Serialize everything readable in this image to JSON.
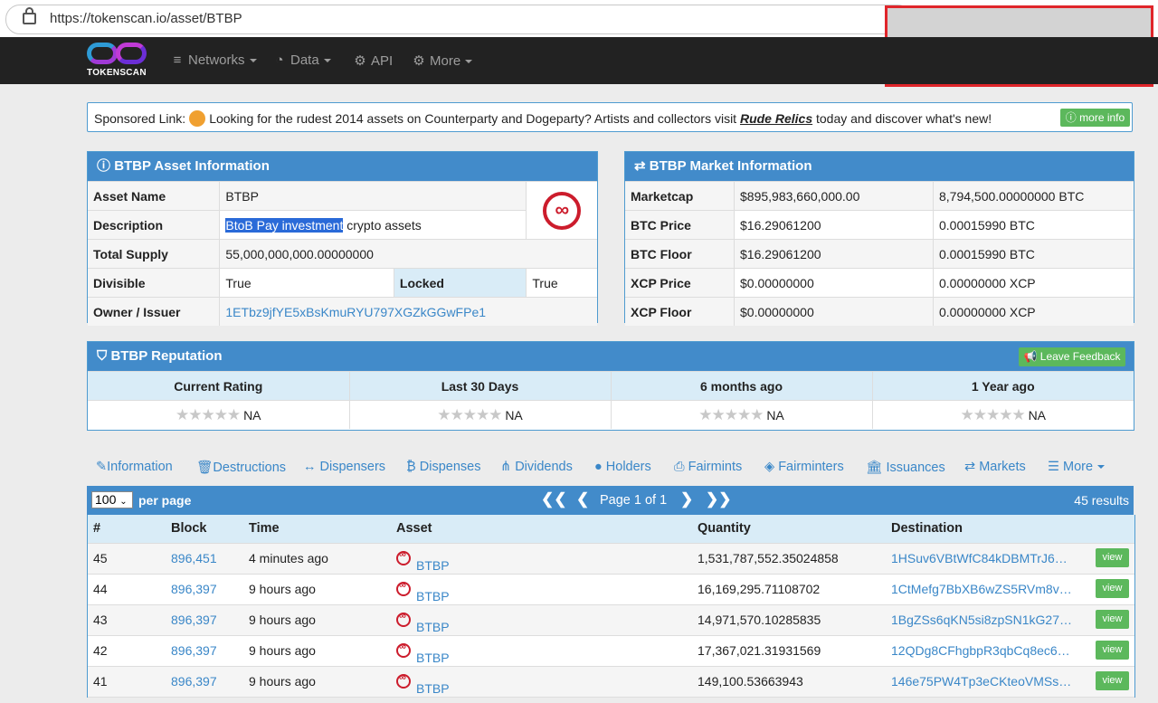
{
  "browser": {
    "url": "https://tokenscan.io/asset/BTBP"
  },
  "nav": {
    "logo_text": "TOKENSCAN",
    "items": [
      {
        "label": "Networks",
        "icon": "database-icon"
      },
      {
        "label": "Data",
        "icon": "dashboard-icon"
      },
      {
        "label": "API",
        "icon": "gears-icon"
      },
      {
        "label": "More",
        "icon": "gear-icon"
      }
    ]
  },
  "sponsor": {
    "prefix": "Sponsored Link:",
    "text1": "Looking for the rudest 2014 assets on Counterparty and Dogeparty? Artists and collectors visit",
    "link": "Rude Relics",
    "text2": "today and discover what's new!",
    "button": "more info"
  },
  "asset_info": {
    "title": "BTBP Asset Information",
    "rows": {
      "name_label": "Asset Name",
      "name_value": "BTBP",
      "desc_label": "Description",
      "desc_highlight": "BtoB Pay investment",
      "desc_rest": " crypto assets",
      "supply_label": "Total Supply",
      "supply_value": "55,000,000,000.00000000",
      "divisible_label": "Divisible",
      "divisible_value": "True",
      "locked_label": "Locked",
      "locked_value": "True",
      "owner_label": "Owner / Issuer",
      "owner_value": "1ETbz9jfYE5xBsKmuRYU797XGZkGGwFPe1"
    }
  },
  "market_info": {
    "title": "BTBP Market Information",
    "rows": [
      {
        "label": "Marketcap",
        "usd": "$895,983,660,000.00",
        "alt": "8,794,500.00000000 BTC"
      },
      {
        "label": "BTC Price",
        "usd": "$16.29061200",
        "alt": "0.00015990 BTC"
      },
      {
        "label": "BTC Floor",
        "usd": "$16.29061200",
        "alt": "0.00015990 BTC"
      },
      {
        "label": "XCP Price",
        "usd": "$0.00000000",
        "alt": "0.00000000 XCP"
      },
      {
        "label": "XCP Floor",
        "usd": "$0.00000000",
        "alt": "0.00000000 XCP"
      }
    ]
  },
  "reputation": {
    "title": "BTBP Reputation",
    "button": "Leave Feedback",
    "columns": [
      {
        "label": "Current Rating",
        "value": "NA"
      },
      {
        "label": "Last 30 Days",
        "value": "NA"
      },
      {
        "label": "6 months ago",
        "value": "NA"
      },
      {
        "label": "1 Year ago",
        "value": "NA"
      }
    ]
  },
  "tabs": [
    "Information",
    "Destructions",
    "Dispensers",
    "Dispenses",
    "Dividends",
    "Holders",
    "Fairmints",
    "Fairminters",
    "Issuances",
    "Markets",
    "More"
  ],
  "results": {
    "per_page_value": "100",
    "per_page_label": "per page",
    "page_text": "Page 1 of 1",
    "count_text": "45 results",
    "headers": [
      "#",
      "Block",
      "Time",
      "Asset",
      "Quantity",
      "Destination"
    ],
    "view_label": "view",
    "rows": [
      {
        "n": "45",
        "block": "896,451",
        "time": "4 minutes ago",
        "asset": "BTBP",
        "qty": "1,531,787,552.35024858",
        "dest": "1HSuv6VBtWfC84kDBMTrJ6…"
      },
      {
        "n": "44",
        "block": "896,397",
        "time": "9 hours ago",
        "asset": "BTBP",
        "qty": "16,169,295.71108702",
        "dest": "1CtMefg7BbXB6wZS5RVm8v…"
      },
      {
        "n": "43",
        "block": "896,397",
        "time": "9 hours ago",
        "asset": "BTBP",
        "qty": "14,971,570.10285835",
        "dest": "1BgZSs6qKN5si8zpSN1kG27…"
      },
      {
        "n": "42",
        "block": "896,397",
        "time": "9 hours ago",
        "asset": "BTBP",
        "qty": "17,367,021.31931569",
        "dest": "12QDg8CFhgbpR3qbCq8ec6…"
      },
      {
        "n": "41",
        "block": "896,397",
        "time": "9 hours ago",
        "asset": "BTBP",
        "qty": "149,100.53663943",
        "dest": "146e75PW4Tp3eCKteoVMSs…"
      }
    ]
  }
}
